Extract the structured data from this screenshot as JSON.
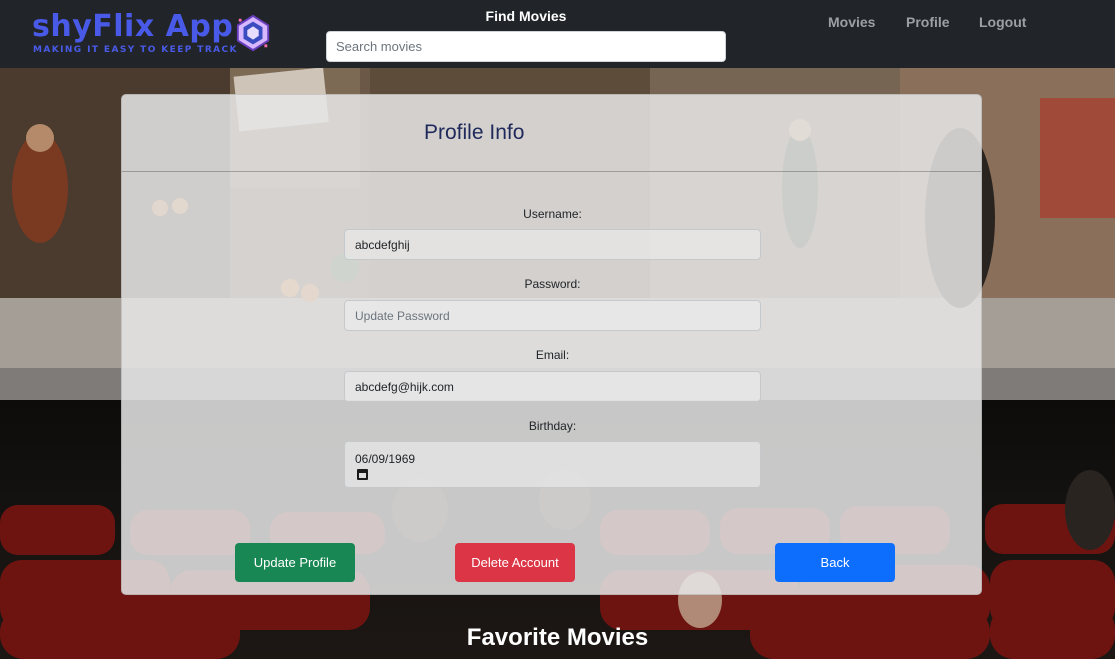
{
  "brand": {
    "title": "shyFlix App",
    "tagline": "MAKING IT EASY TO KEEP TRACK",
    "color": "#4a5ae8"
  },
  "search": {
    "heading": "Find Movies",
    "placeholder": "Search movies",
    "value": ""
  },
  "nav": {
    "items": [
      {
        "label": "Movies"
      },
      {
        "label": "Profile"
      },
      {
        "label": "Logout"
      }
    ]
  },
  "profile": {
    "title": "Profile Info",
    "fields": {
      "username": {
        "label": "Username:",
        "value": "abcdefghij"
      },
      "password": {
        "label": "Password:",
        "placeholder": "Update Password",
        "value": ""
      },
      "email": {
        "label": "Email:",
        "value": "abcdefg@hijk.com"
      },
      "birthday": {
        "label": "Birthday:",
        "value": "06/09/1969"
      }
    },
    "buttons": {
      "update": "Update Profile",
      "delete": "Delete Account",
      "back": "Back"
    }
  },
  "favorites": {
    "title": "Favorite Movies"
  },
  "colors": {
    "navbar": "#212529",
    "update": "#198754",
    "delete": "#dc3545",
    "back": "#0d6efd"
  }
}
